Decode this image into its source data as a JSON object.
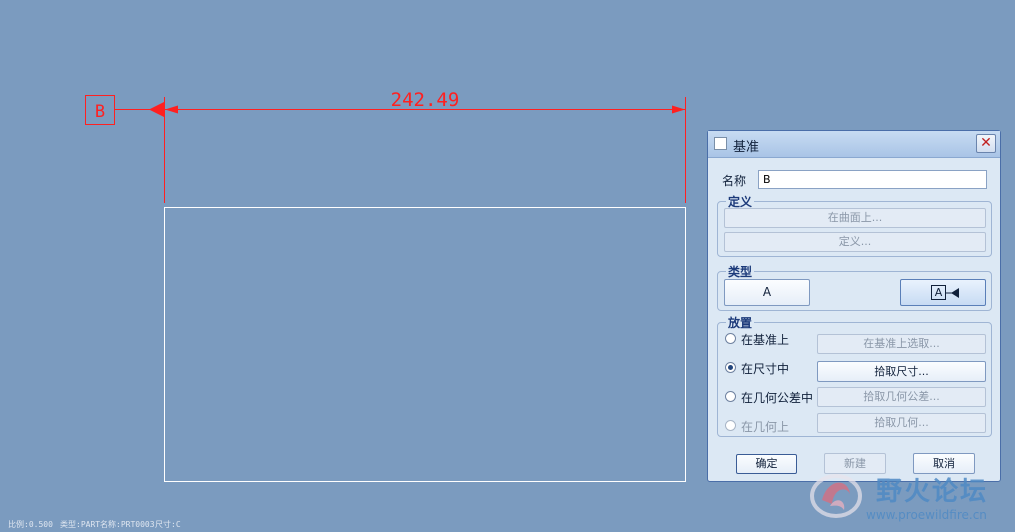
{
  "canvas": {
    "datum_tag": "B",
    "dimension_value": "242.49"
  },
  "dialog": {
    "title": "基准",
    "name_label": "名称",
    "name_value": "B",
    "definition": {
      "title": "定义",
      "on_surface_button": "在曲面上...",
      "define_button": "定义..."
    },
    "type": {
      "title": "类型",
      "button_a": "A",
      "button_a_arrow": "A"
    },
    "placement": {
      "title": "放置",
      "options": [
        {
          "label": "在基准上",
          "button": "在基准上选取...",
          "checked": false,
          "enabled": true,
          "button_enabled": false
        },
        {
          "label": "在尺寸中",
          "button": "拾取尺寸...",
          "checked": true,
          "enabled": true,
          "button_enabled": true
        },
        {
          "label": "在几何公差中",
          "button": "拾取几何公差...",
          "checked": false,
          "enabled": true,
          "button_enabled": false
        },
        {
          "label": "在几何上",
          "button": "拾取几何...",
          "checked": false,
          "enabled": false,
          "button_enabled": false
        }
      ]
    },
    "ok_button": "确定",
    "new_button": "新建",
    "cancel_button": "取消"
  },
  "status_bar": {
    "scale": "比例:0.500",
    "type": "类型:PART",
    "name": "名称:PRT0003",
    "size": "尺寸:C"
  },
  "watermark": {
    "text": "野火论坛",
    "url": "www.proewildfire.cn"
  },
  "colors": {
    "background": "#7b9bbf",
    "dimension": "#ff2020",
    "sketch_line": "#ffffff"
  }
}
